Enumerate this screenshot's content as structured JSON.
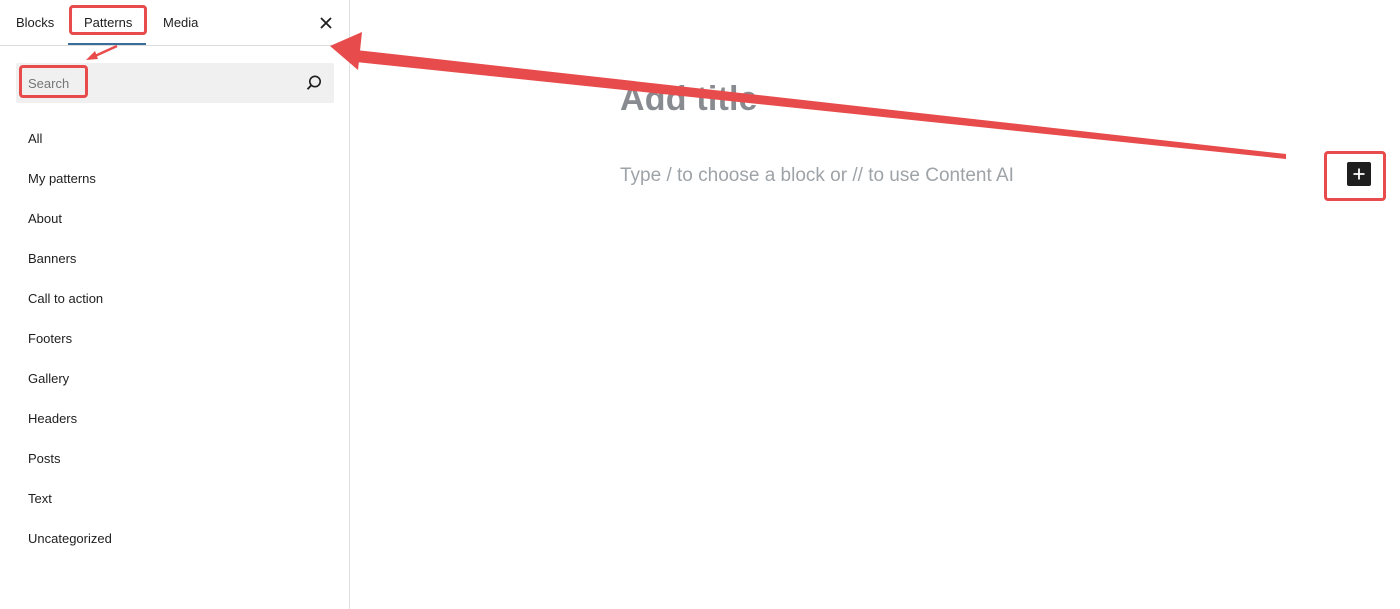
{
  "sidebar": {
    "tabs": [
      {
        "label": "Blocks"
      },
      {
        "label": "Patterns"
      },
      {
        "label": "Media"
      }
    ],
    "active_tab": "Patterns",
    "search": {
      "placeholder": "Search",
      "value": ""
    },
    "categories": [
      {
        "label": "All"
      },
      {
        "label": "My patterns"
      },
      {
        "label": "About"
      },
      {
        "label": "Banners"
      },
      {
        "label": "Call to action"
      },
      {
        "label": "Footers"
      },
      {
        "label": "Gallery"
      },
      {
        "label": "Headers"
      },
      {
        "label": "Posts"
      },
      {
        "label": "Text"
      },
      {
        "label": "Uncategorized"
      }
    ]
  },
  "editor": {
    "title_placeholder": "Add title",
    "block_placeholder": "Type / to choose a block or // to use Content AI"
  },
  "annotation": {
    "color": "#e84b4b"
  },
  "icons": {
    "close": "close-icon",
    "search": "search-icon",
    "add": "plus-icon"
  }
}
